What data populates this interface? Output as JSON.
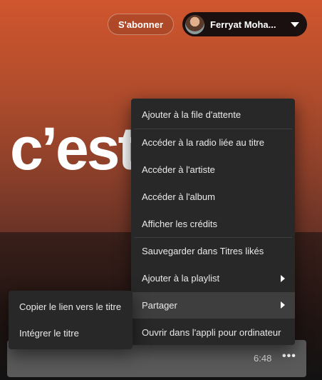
{
  "header": {
    "title": "c’est",
    "subscribe_label": "S'abonner",
    "user_name": "Ferryat Moha..."
  },
  "context_menu": {
    "items": [
      {
        "label": "Ajouter à la file d'attente"
      },
      {
        "label": "Accéder à la radio liée au titre"
      },
      {
        "label": "Accéder à l'artiste"
      },
      {
        "label": "Accéder à l'album"
      },
      {
        "label": "Afficher les crédits"
      },
      {
        "label": "Sauvegarder dans Titres likés"
      },
      {
        "label": "Ajouter à la playlist"
      },
      {
        "label": "Partager"
      },
      {
        "label": "Ouvrir dans l'appli pour ordinateur"
      }
    ]
  },
  "share_submenu": {
    "items": [
      {
        "label": "Copier le lien vers le titre"
      },
      {
        "label": "Intégrer le titre"
      }
    ]
  },
  "track": {
    "duration": "6:48",
    "more_label": "•••"
  },
  "colors": {
    "header_gradient_top": "#d0562e",
    "menu_bg": "#282828",
    "menu_active": "#3e3e3e"
  }
}
